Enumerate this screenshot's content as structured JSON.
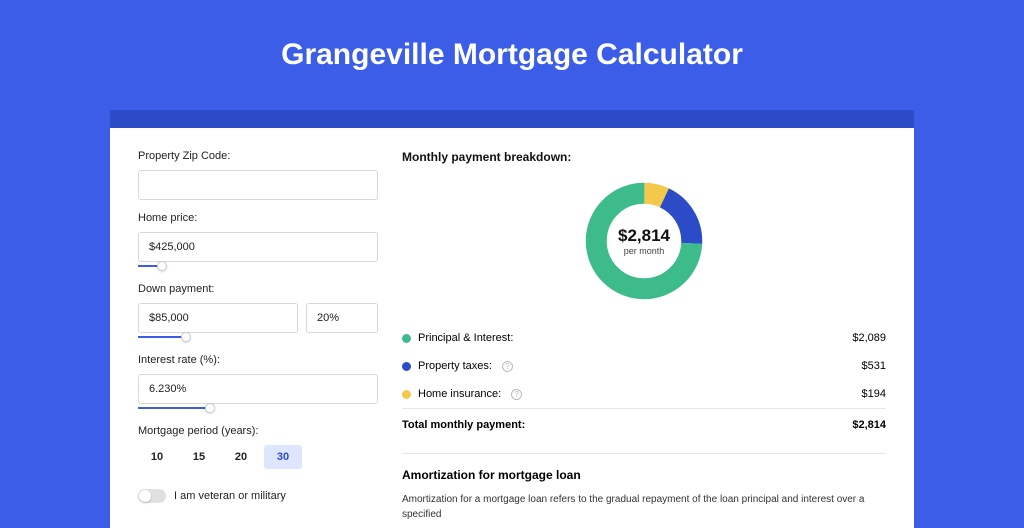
{
  "title": "Grangeville Mortgage Calculator",
  "fields": {
    "zip_label": "Property Zip Code:",
    "zip_value": "",
    "home_price_label": "Home price:",
    "home_price_value": "$425,000",
    "down_payment_label": "Down payment:",
    "down_payment_value": "$85,000",
    "down_payment_pct": "20%",
    "interest_label": "Interest rate (%):",
    "interest_value": "6.230%",
    "period_label": "Mortgage period (years):",
    "periods": [
      "10",
      "15",
      "20",
      "30"
    ],
    "period_selected": "30",
    "veteran_label": "I am veteran or military"
  },
  "breakdown": {
    "title": "Monthly payment breakdown:",
    "total_amount": "$2,814",
    "per_month": "per month",
    "items": [
      {
        "label": "Principal & Interest:",
        "value": "$2,089",
        "color": "green"
      },
      {
        "label": "Property taxes:",
        "value": "$531",
        "color": "blue",
        "info": true
      },
      {
        "label": "Home insurance:",
        "value": "$194",
        "color": "yellow",
        "info": true
      }
    ],
    "total_label": "Total monthly payment:",
    "total_value": "$2,814"
  },
  "amortization": {
    "title": "Amortization for mortgage loan",
    "text": "Amortization for a mortgage loan refers to the gradual repayment of the loan principal and interest over a specified"
  },
  "chart_data": {
    "type": "pie",
    "title": "Monthly payment breakdown",
    "series": [
      {
        "name": "Principal & Interest",
        "value": 2089,
        "color": "#3dbb8b"
      },
      {
        "name": "Property taxes",
        "value": 531,
        "color": "#2c4cc7"
      },
      {
        "name": "Home insurance",
        "value": 194,
        "color": "#f4c94b"
      }
    ],
    "total": 2814,
    "center_label": "$2,814 per month"
  }
}
